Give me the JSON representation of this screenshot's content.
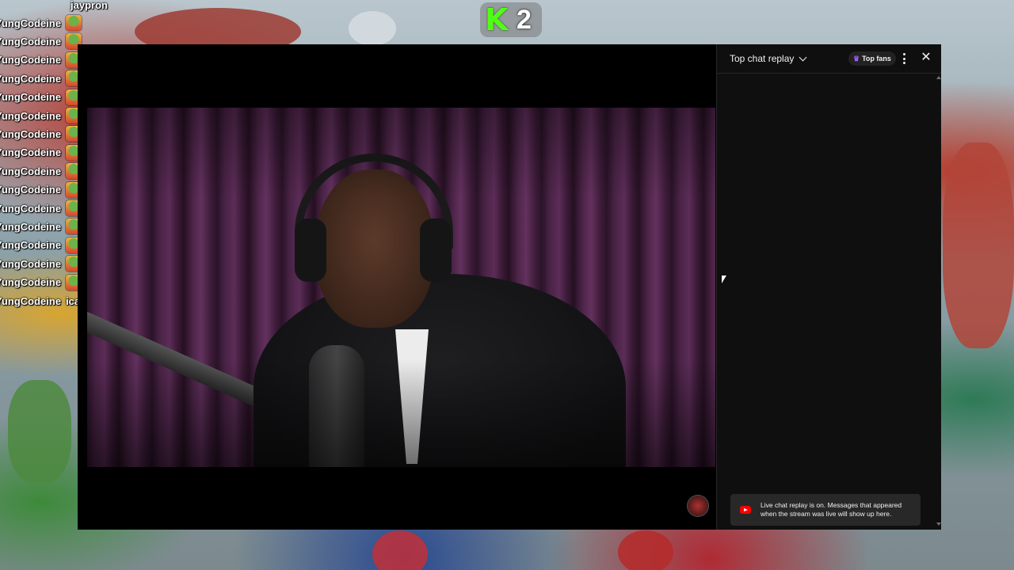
{
  "overlay_chat": {
    "header_user": "jaypron",
    "lines": [
      {
        "user": "YungCodeine",
        "message": ""
      },
      {
        "user": "YungCodeine",
        "message": ""
      },
      {
        "user": "YungCodeine",
        "message": ""
      },
      {
        "user": "YungCodeine",
        "message": ""
      },
      {
        "user": "YungCodeine",
        "message": ""
      },
      {
        "user": "YungCodeine",
        "message": ""
      },
      {
        "user": "YungCodeine",
        "message": ""
      },
      {
        "user": "YungCodeine",
        "message": ""
      },
      {
        "user": "YungCodeine",
        "message": ""
      },
      {
        "user": "YungCodeine",
        "message": ""
      },
      {
        "user": "YungCodeine",
        "message": ""
      },
      {
        "user": "YungCodeine",
        "message": ""
      },
      {
        "user": "YungCodeine",
        "message": ""
      },
      {
        "user": "YungCodeine",
        "message": ""
      },
      {
        "user": "YungCodeine",
        "message": ""
      },
      {
        "user": "YungCodeine",
        "message": "icanthear"
      }
    ],
    "emote": "pepe-emote"
  },
  "counter": {
    "icon": "kick-k-icon",
    "value": "2",
    "color": "#53fc18"
  },
  "chat_panel": {
    "title": "Top chat replay",
    "top_fans_label": "Top fans",
    "notice_text": "Live chat replay is on. Messages that appeared when the stream was live will show up here.",
    "accent": "#ff0000"
  }
}
